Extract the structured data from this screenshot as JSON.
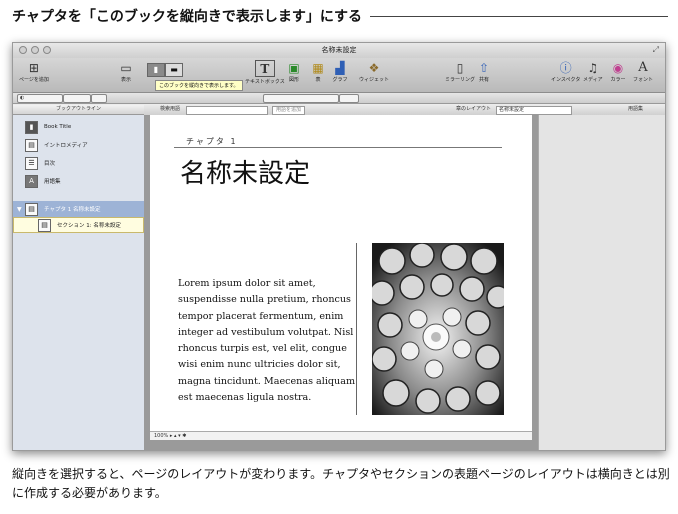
{
  "heading": "チャプタを「このブックを縦向きで表示します」にする",
  "window": {
    "title": "名称未設定",
    "toolbar": {
      "items": [
        {
          "icon": "add-page-icon",
          "label": "ページを追加"
        },
        {
          "icon": "view-icon",
          "label": "表示"
        },
        {
          "icon": "textbox-icon",
          "label": "テキストボックス"
        },
        {
          "icon": "shape-icon",
          "label": "図形"
        },
        {
          "icon": "table-icon",
          "label": "表"
        },
        {
          "icon": "chart-icon",
          "label": "グラフ"
        },
        {
          "icon": "widget-icon",
          "label": "ウィジェット"
        },
        {
          "icon": "mirror-icon",
          "label": "ミラーリング"
        },
        {
          "icon": "share-icon",
          "label": "共有"
        },
        {
          "icon": "inspector-icon",
          "label": "インスペクタ"
        },
        {
          "icon": "media-icon",
          "label": "メディア"
        },
        {
          "icon": "colors-icon",
          "label": "カラー"
        },
        {
          "icon": "fonts-icon",
          "label": "フォント"
        }
      ],
      "tooltip": "このブックを縦向きで表示します。"
    },
    "sidebar": {
      "header": "ブックアウトライン",
      "items": [
        {
          "label": "Book Title"
        },
        {
          "label": "イントロメディア"
        },
        {
          "label": "目次"
        },
        {
          "label": "用語集"
        },
        {
          "label": "チャプタ 1 名称未設定"
        },
        {
          "label": "セクション 1: 名称未設定"
        }
      ]
    },
    "docbar": {
      "field_label": "検索用語",
      "button": "用語を追加",
      "layout_label": "章のレイアウト",
      "layout_value": "名称未設定",
      "right_button": "用語集"
    },
    "page": {
      "chapter_label": "チャプタ 1",
      "chapter_title": "名称未設定",
      "body": "Lorem ipsum dolor sit amet, suspendisse nulla pretium, rhoncus tempor placerat fermentum, enim integer ad vestibulum volutpat. Nisl rhoncus turpis est, vel elit, congue wisi enim nunc ultricies dolor sit, magna tincidunt. Maecenas aliquam est maecenas ligula nostra."
    },
    "status": {
      "zoom": "100%"
    }
  },
  "caption": "縦向きを選択すると、ページのレイアウトが変わります。チャプタやセクションの表題ページのレイアウトは横向きとは別に作成する必要があります。"
}
